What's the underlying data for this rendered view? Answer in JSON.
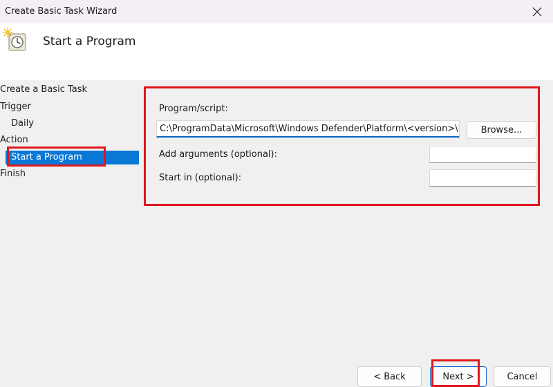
{
  "window": {
    "title": "Create Basic Task Wizard",
    "close_glyph": "✕"
  },
  "header": {
    "title": "Start a Program",
    "icon": "task-scheduler-clock-icon"
  },
  "nav": {
    "items": [
      {
        "label": "Create a Basic Task"
      },
      {
        "label": "Trigger"
      },
      {
        "label": "Daily"
      },
      {
        "label": "Action"
      },
      {
        "label": "Start a Program",
        "selected": true
      },
      {
        "label": "Finish"
      }
    ]
  },
  "form": {
    "program_label": "Program/script:",
    "program_value": "C:\\ProgramData\\Microsoft\\Windows Defender\\Platform\\<version>\\M",
    "browse_label": "Browse...",
    "arguments_label": "Add arguments (optional):",
    "arguments_value": "",
    "start_in_label": "Start in (optional):",
    "start_in_value": ""
  },
  "footer": {
    "back_label": "< Back",
    "next_label": "Next >",
    "cancel_label": "Cancel"
  },
  "colors": {
    "highlight": "#e0151b",
    "selection": "#0a78d7",
    "accent": "#0a64c2"
  }
}
